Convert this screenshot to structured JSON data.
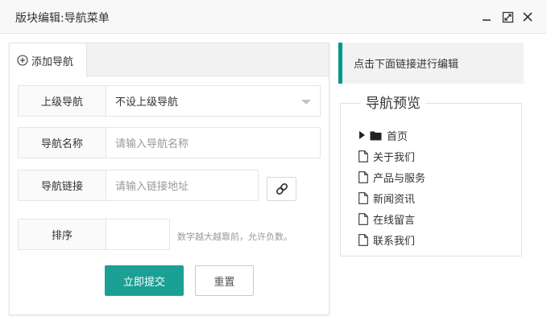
{
  "window": {
    "title": "版块编辑:导航菜单"
  },
  "form": {
    "tab_label": "添加导航",
    "parent": {
      "label": "上级导航",
      "value": "不设上级导航"
    },
    "name": {
      "label": "导航名称",
      "placeholder": "请输入导航名称"
    },
    "link": {
      "label": "导航链接",
      "placeholder": "请输入链接地址"
    },
    "order": {
      "label": "排序",
      "value": "",
      "hint": "数字越大越靠前，允许负数。"
    },
    "submit_label": "立即提交",
    "reset_label": "重置"
  },
  "preview": {
    "tip": "点击下面链接进行编辑",
    "title": "导航预览",
    "items": [
      {
        "label": "首页",
        "icon": "folder-icon",
        "expandable": true
      },
      {
        "label": "关于我们",
        "icon": "file-icon"
      },
      {
        "label": "产品与服务",
        "icon": "file-icon"
      },
      {
        "label": "新闻资讯",
        "icon": "file-icon"
      },
      {
        "label": "在线留言",
        "icon": "file-icon"
      },
      {
        "label": "联系我们",
        "icon": "file-icon"
      }
    ]
  },
  "colors": {
    "accent": "#1aa094",
    "tip_border": "#009688"
  }
}
